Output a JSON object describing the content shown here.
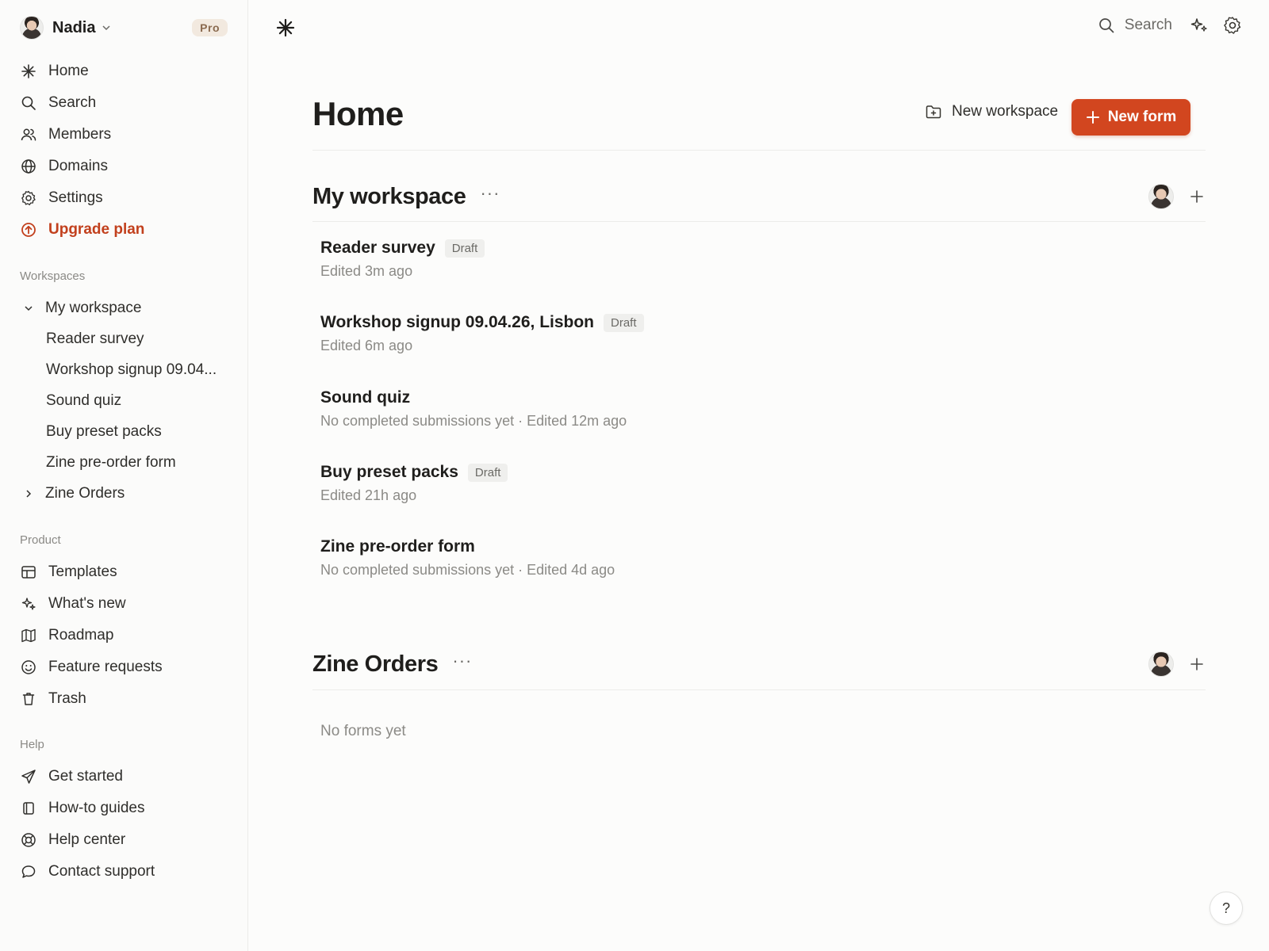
{
  "user": {
    "name": "Nadia",
    "plan_badge": "Pro"
  },
  "nav": {
    "home": "Home",
    "search": "Search",
    "members": "Members",
    "domains": "Domains",
    "settings": "Settings",
    "upgrade": "Upgrade plan"
  },
  "workspaces_section": {
    "label": "Workspaces",
    "items": [
      {
        "label": "My workspace",
        "expanded": true
      },
      {
        "label": "Reader survey"
      },
      {
        "label": "Workshop signup 09.04..."
      },
      {
        "label": "Sound quiz"
      },
      {
        "label": "Buy preset packs"
      },
      {
        "label": "Zine pre-order form"
      },
      {
        "label": "Zine Orders",
        "expanded": false
      }
    ]
  },
  "product_section": {
    "label": "Product",
    "items": [
      "Templates",
      "What's new",
      "Roadmap",
      "Feature requests",
      "Trash"
    ]
  },
  "help_section": {
    "label": "Help",
    "items": [
      "Get started",
      "How-to guides",
      "Help center",
      "Contact support"
    ]
  },
  "topbar": {
    "search_label": "Search"
  },
  "page": {
    "title": "Home",
    "new_workspace_label": "New workspace",
    "new_form_label": "New form"
  },
  "workspaces": [
    {
      "title": "My workspace",
      "more": "···",
      "forms": [
        {
          "title": "Reader survey",
          "badge": "Draft",
          "meta": "Edited 3m ago"
        },
        {
          "title": "Workshop signup 09.04.26, Lisbon",
          "badge": "Draft",
          "meta": "Edited 6m ago"
        },
        {
          "title": "Sound quiz",
          "badge": "",
          "meta": "No completed submissions yet · Edited 12m ago"
        },
        {
          "title": "Buy preset packs",
          "badge": "Draft",
          "meta": "Edited 21h ago"
        },
        {
          "title": "Zine pre-order form",
          "badge": "",
          "meta": "No completed submissions yet · Edited 4d ago"
        }
      ]
    },
    {
      "title": "Zine Orders",
      "more": "···",
      "empty_text": "No forms yet"
    }
  ],
  "help_button": "?",
  "colors": {
    "accent": "#d2461f",
    "upgrade": "#c2401d",
    "badge_bg": "#efefed",
    "pro_bg": "#f2e9df"
  },
  "icons": {
    "home": "asterisk-icon",
    "search": "search-icon",
    "members": "users-icon",
    "domains": "globe-icon",
    "settings": "gear-icon",
    "upgrade": "arrow-up-circle-icon"
  }
}
